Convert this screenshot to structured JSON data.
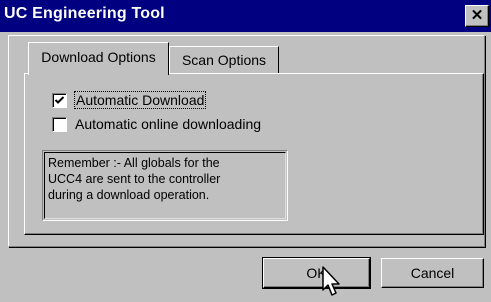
{
  "window": {
    "title": "UC Engineering Tool",
    "close_glyph": "✕"
  },
  "tabs": [
    {
      "label": "Download Options",
      "active": true
    },
    {
      "label": "Scan Options",
      "active": false
    }
  ],
  "options": [
    {
      "label": "Automatic Download",
      "checked": true
    },
    {
      "label": "Automatic online downloading",
      "checked": false
    }
  ],
  "note": "Remember :- All globals for the\nUCC4 are sent to the controller\nduring a download operation.",
  "buttons": {
    "ok": "OK",
    "cancel": "Cancel"
  },
  "icons": {
    "close": "close-icon",
    "check": "checkmark-icon",
    "cursor": "mouse-pointer-icon"
  },
  "colors": {
    "titlebar": "#000080",
    "face": "#c0c0c0"
  }
}
